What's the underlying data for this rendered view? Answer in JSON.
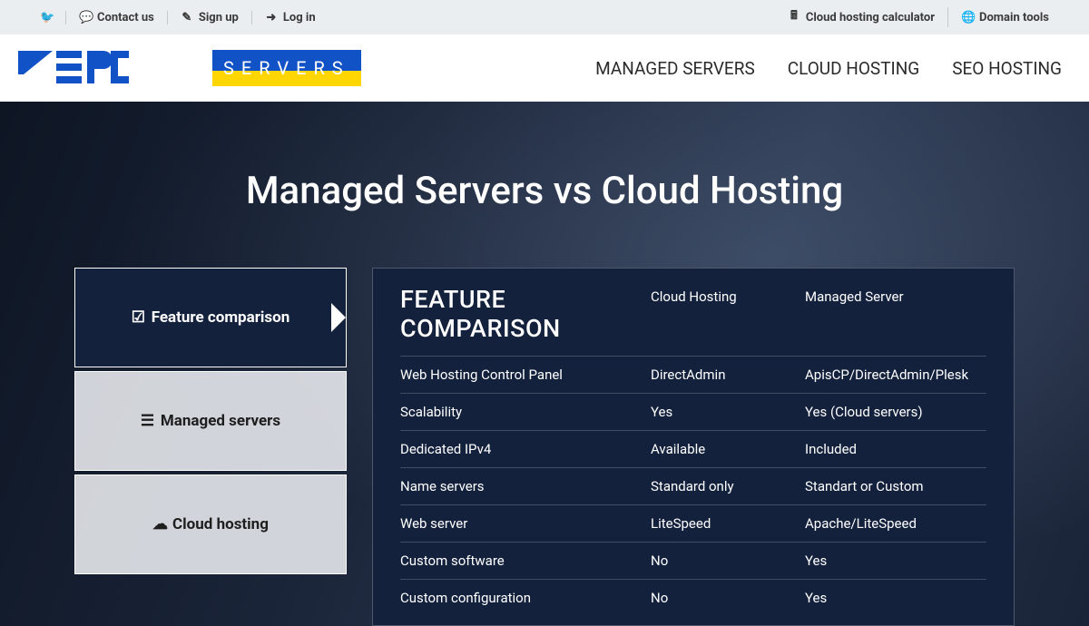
{
  "topbar": {
    "left": [
      {
        "icon": "twitter",
        "label": ""
      },
      {
        "icon": "comment",
        "label": "Contact us"
      },
      {
        "icon": "edit",
        "label": "Sign up"
      },
      {
        "icon": "login",
        "label": "Log in"
      }
    ],
    "right": [
      {
        "icon": "calculator",
        "label": "Cloud hosting calculator"
      },
      {
        "icon": "globe",
        "label": "Domain tools"
      }
    ]
  },
  "logo": {
    "text": "ZERO",
    "badge": "SERVERS"
  },
  "nav": [
    {
      "label": "MANAGED SERVERS"
    },
    {
      "label": "CLOUD HOSTING"
    },
    {
      "label": "SEO HOSTING"
    }
  ],
  "hero_title": "Managed Servers vs Cloud Hosting",
  "tabs": [
    {
      "icon": "check-square",
      "label": "Feature comparison",
      "active": true
    },
    {
      "icon": "server",
      "label": "Managed servers",
      "active": false
    },
    {
      "icon": "cloud",
      "label": "Cloud hosting",
      "active": false
    }
  ],
  "comparison": {
    "title": "FEATURE COMPARISON",
    "col1": "Cloud Hosting",
    "col2": "Managed Server",
    "rows": [
      {
        "feature": "Web Hosting Control Panel",
        "c1": "DirectAdmin",
        "c2": "ApisCP/DirectAdmin/Plesk"
      },
      {
        "feature": "Scalability",
        "c1": "Yes",
        "c2": "Yes (Cloud servers)"
      },
      {
        "feature": "Dedicated IPv4",
        "c1": "Available",
        "c2": "Included"
      },
      {
        "feature": "Name servers",
        "c1": "Standard only",
        "c2": "Standart or Custom"
      },
      {
        "feature": "Web server",
        "c1": "LiteSpeed",
        "c2": "Apache/LiteSpeed"
      },
      {
        "feature": "Custom software",
        "c1": "No",
        "c2": "Yes"
      },
      {
        "feature": "Custom configuration",
        "c1": "No",
        "c2": "Yes"
      }
    ]
  }
}
